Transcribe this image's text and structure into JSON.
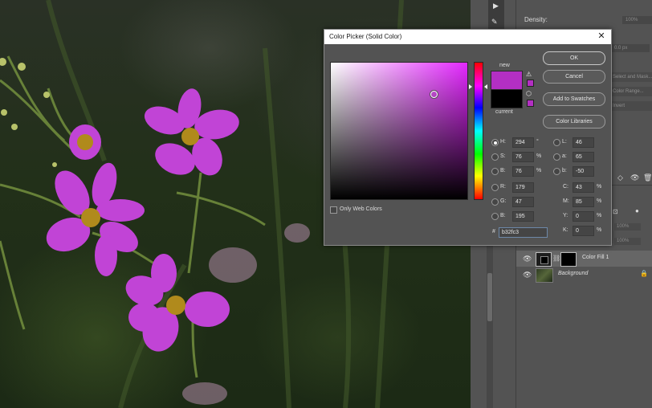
{
  "dialog": {
    "title": "Color Picker (Solid Color)",
    "new_label": "new",
    "current_label": "current",
    "new_color": "#b32fc3",
    "current_color": "#000000",
    "buttons": {
      "ok": "OK",
      "cancel": "Cancel",
      "add_to_swatches": "Add to Swatches",
      "color_libraries": "Color Libraries"
    },
    "only_web_colors": "Only Web Colors",
    "hsb": {
      "h": {
        "label": "H:",
        "value": "294",
        "unit": "°"
      },
      "s": {
        "label": "S:",
        "value": "76",
        "unit": "%"
      },
      "b": {
        "label": "B:",
        "value": "76",
        "unit": "%"
      }
    },
    "rgb": {
      "r": {
        "label": "R:",
        "value": "179"
      },
      "g": {
        "label": "G:",
        "value": "47"
      },
      "b": {
        "label": "B:",
        "value": "195"
      }
    },
    "lab": {
      "l": {
        "label": "L:",
        "value": "46"
      },
      "a": {
        "label": "a:",
        "value": "65"
      },
      "b": {
        "label": "b:",
        "value": "-50"
      }
    },
    "cmyk": {
      "c": {
        "label": "C:",
        "value": "43",
        "unit": "%"
      },
      "m": {
        "label": "M:",
        "value": "85",
        "unit": "%"
      },
      "y": {
        "label": "Y:",
        "value": "0",
        "unit": "%"
      },
      "k": {
        "label": "K:",
        "value": "0",
        "unit": "%"
      }
    },
    "hex_label": "#",
    "hex_value": "b32fc3"
  },
  "properties": {
    "density_label": "Density:",
    "density_value": "100%",
    "feather_value": "0.0 px",
    "mask_buttons": [
      "Select and Mask...",
      "Color Range...",
      "Invert"
    ]
  },
  "layers": {
    "opacity_value": "100%",
    "fill_value": "100%",
    "items": [
      {
        "name": "Color Fill 1"
      },
      {
        "name": "Background"
      }
    ]
  }
}
